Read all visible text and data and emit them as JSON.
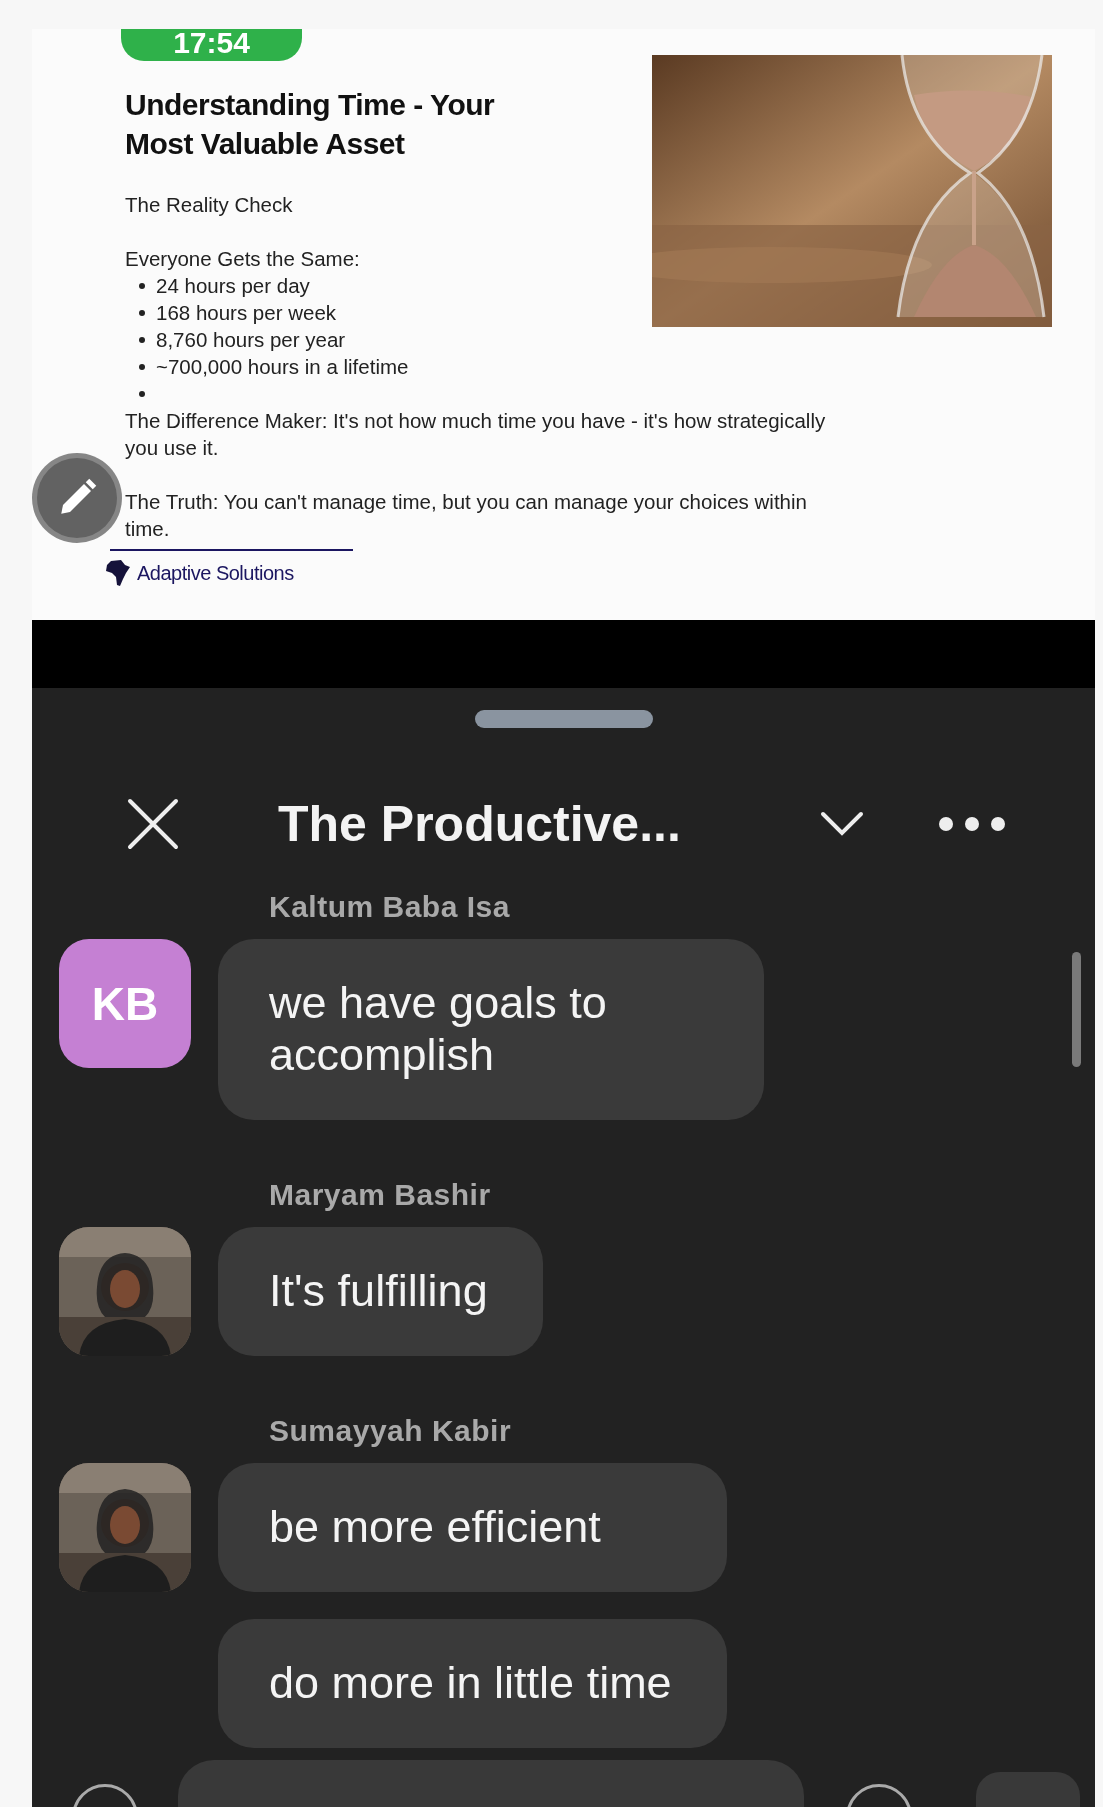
{
  "status_bar": {
    "time": "17:54"
  },
  "slide": {
    "title": "Understanding Time - Your Most Valuable Asset",
    "subtitle": "The Reality Check",
    "list_heading": "Everyone Gets the Same:",
    "bullets": [
      "24 hours per day",
      "168 hours per week",
      "8,760 hours per year",
      "~700,000 hours in a lifetime"
    ],
    "trailing_empty_bullet": true,
    "paragraphs": [
      "The Difference Maker: It's not how much time you have - it's how strategically you use it.",
      "The Truth: You can't manage time, but you can manage your choices within time."
    ],
    "logo": "Adaptive Solutions",
    "image": {
      "kind": "picture"
    }
  },
  "chat": {
    "title": "The Productive...",
    "messages": [
      {
        "sender": "Kaltum Baba Isa",
        "avatar": {
          "kind": "initials",
          "text": "KB",
          "color": "#c580d3"
        },
        "bubbles": [
          "we have goals to accomplish"
        ]
      },
      {
        "sender": "Maryam Bashir",
        "avatar": {
          "kind": "picture"
        },
        "bubbles": [
          "It's fulfilling"
        ]
      },
      {
        "sender": "Sumayyah Kabir",
        "avatar": {
          "kind": "picture"
        },
        "bubbles": [
          "be more efficient",
          "do more in little time"
        ]
      }
    ]
  }
}
